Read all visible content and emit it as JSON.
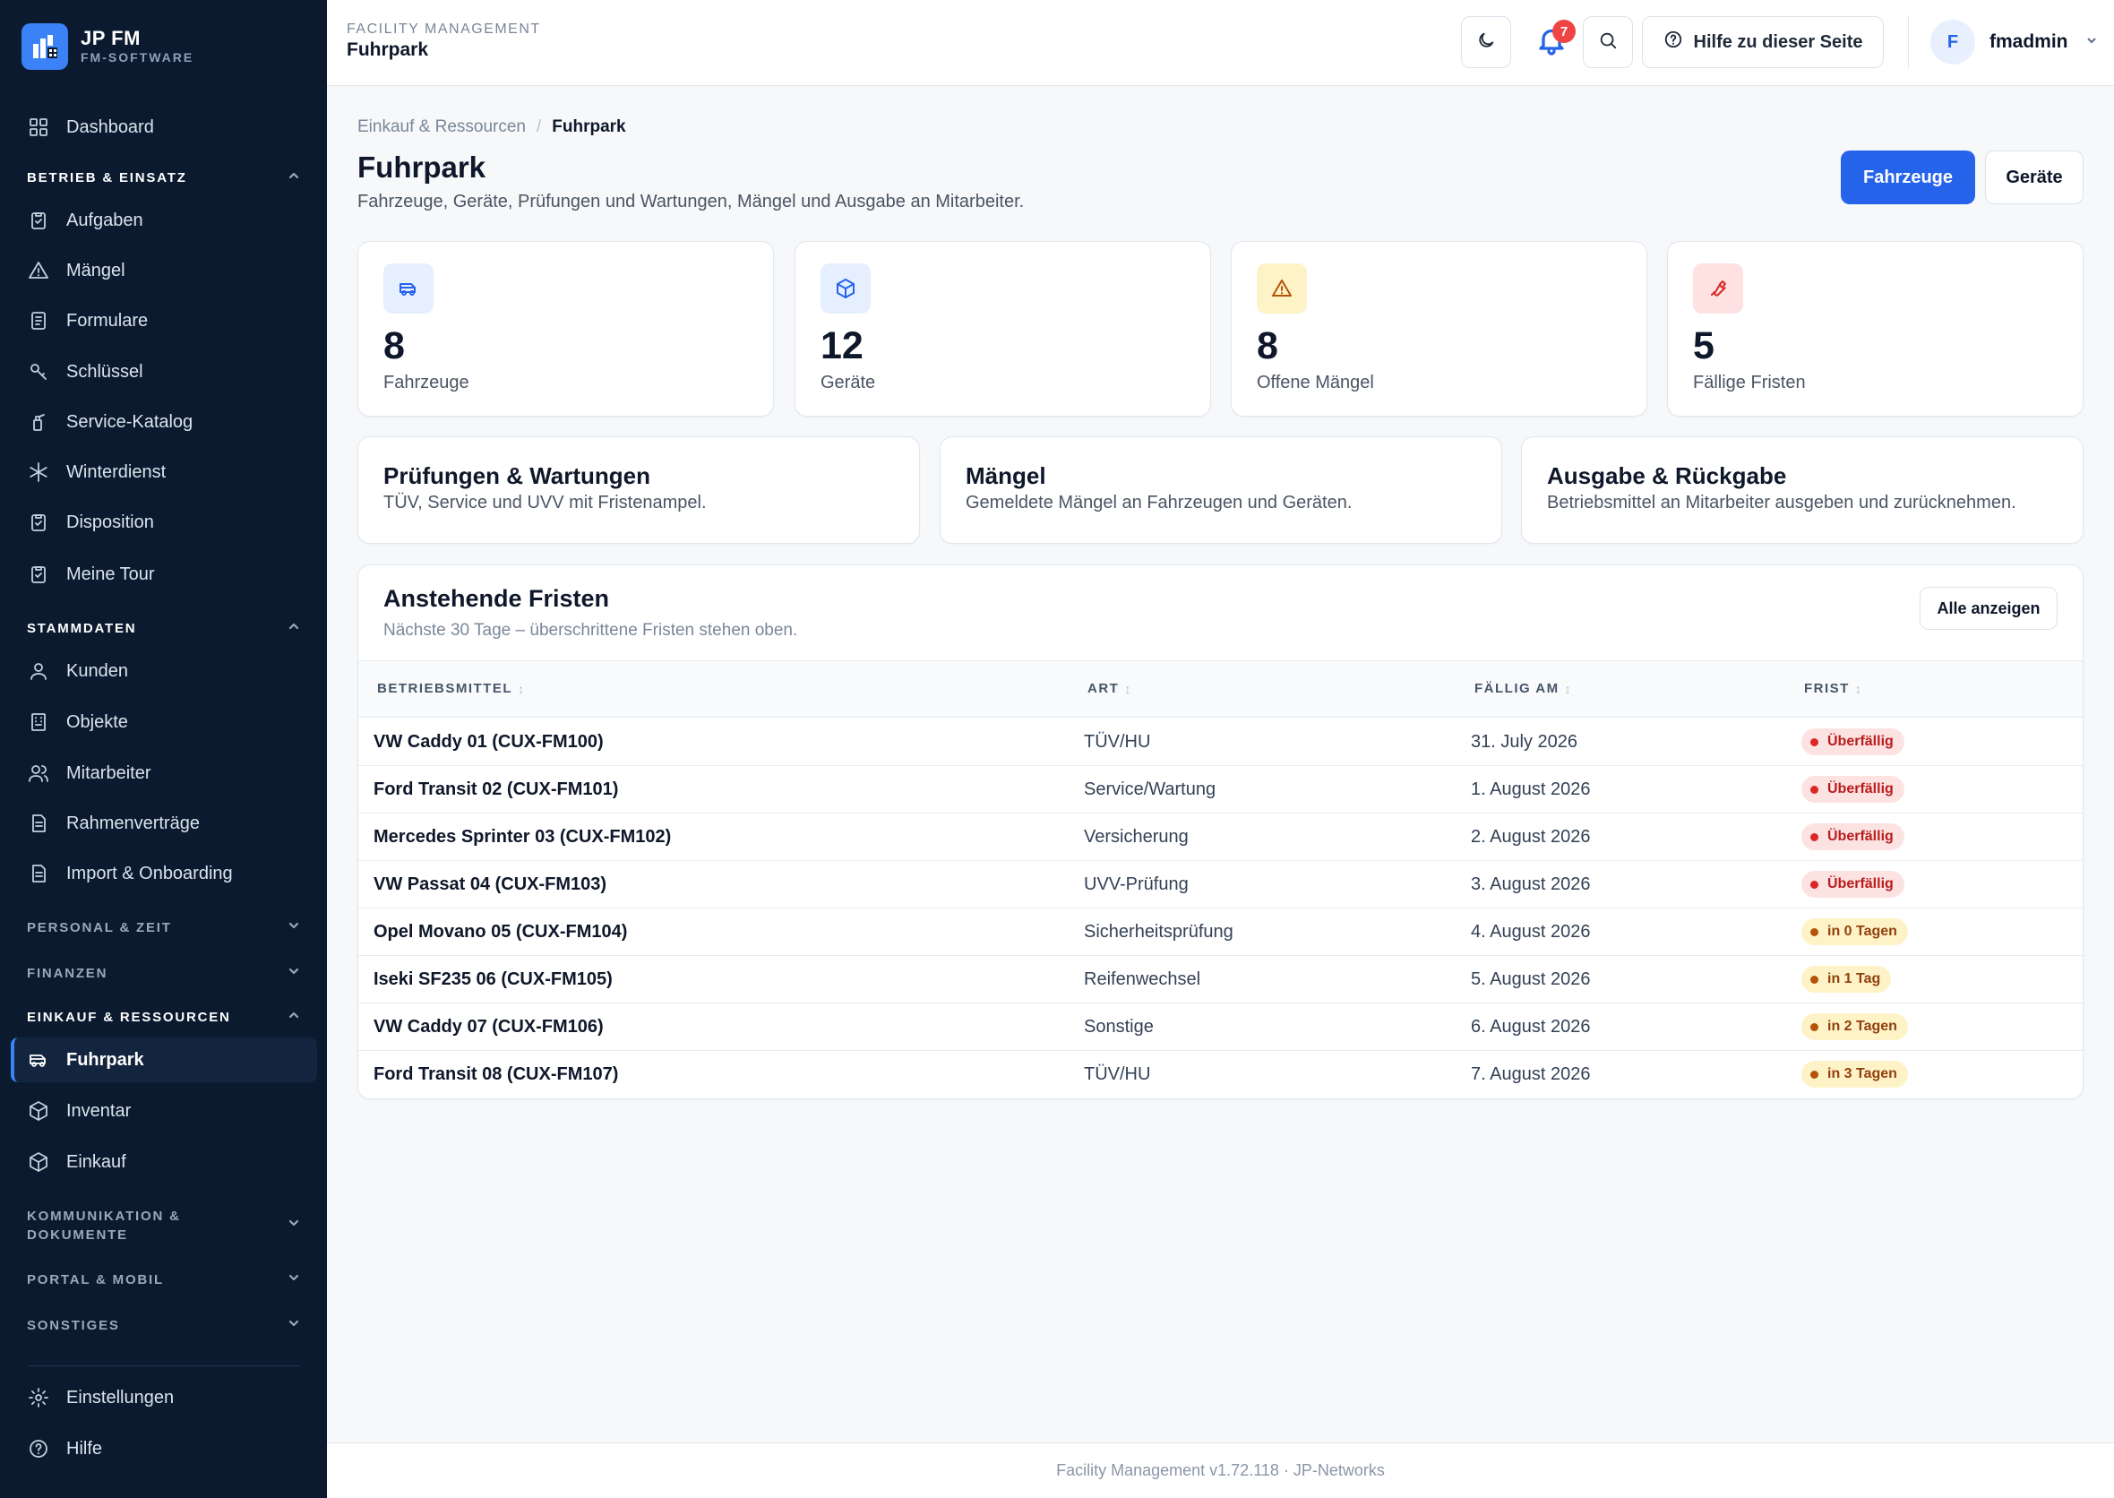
{
  "brand": {
    "name": "JP FM",
    "subtitle": "FM-SOFTWARE"
  },
  "sidebar": {
    "dashboard": "Dashboard",
    "sections": {
      "betrieb": "BETRIEB & EINSATZ",
      "stammdaten": "STAMMDATEN",
      "personal": "PERSONAL & ZEIT",
      "finanzen": "FINANZEN",
      "einkauf": "EINKAUF & RESSOURCEN",
      "kommunikation_1": "KOMMUNIKATION &",
      "kommunikation_2": "DOKUMENTE",
      "portal": "PORTAL & MOBIL",
      "sonstiges": "SONSTIGES"
    },
    "betrieb_items": [
      "Aufgaben",
      "Mängel",
      "Formulare",
      "Schlüssel",
      "Service-Katalog",
      "Winterdienst",
      "Disposition",
      "Meine Tour"
    ],
    "stammdaten_items": [
      "Kunden",
      "Objekte",
      "Mitarbeiter",
      "Rahmenverträge",
      "Import & Onboarding"
    ],
    "einkauf_items": [
      "Fuhrpark",
      "Inventar",
      "Einkauf"
    ],
    "bottom_items": [
      "Einstellungen",
      "Hilfe"
    ]
  },
  "topbar": {
    "section": "FACILITY MANAGEMENT",
    "title": "Fuhrpark",
    "notification_count": "7",
    "help_label": "Hilfe zu dieser Seite",
    "avatar_initial": "F",
    "username": "fmadmin"
  },
  "breadcrumb": {
    "parent": "Einkauf & Ressourcen",
    "separator": "/",
    "current": "Fuhrpark"
  },
  "header": {
    "title": "Fuhrpark",
    "subtitle": "Fahrzeuge, Geräte, Prüfungen und Wartungen, Mängel und Ausgabe an Mitarbeiter.",
    "btn_primary": "Fahrzeuge",
    "btn_secondary": "Geräte"
  },
  "stats": [
    {
      "value": "8",
      "label": "Fahrzeuge",
      "icon": "van-icon",
      "bg": "#e6efff",
      "color": "#2563eb"
    },
    {
      "value": "12",
      "label": "Geräte",
      "icon": "box-icon",
      "bg": "#e6efff",
      "color": "#2563eb"
    },
    {
      "value": "8",
      "label": "Offene Mängel",
      "icon": "warning-icon",
      "bg": "#fef3c7",
      "color": "#b45309"
    },
    {
      "value": "5",
      "label": "Fällige Fristen",
      "icon": "wrench-icon",
      "bg": "#fee2e2",
      "color": "#dc2626"
    }
  ],
  "link_cards": [
    {
      "title": "Prüfungen & Wartungen",
      "subtitle": "TÜV, Service und UVV mit Fristenampel."
    },
    {
      "title": "Mängel",
      "subtitle": "Gemeldete Mängel an Fahrzeugen und Geräten."
    },
    {
      "title": "Ausgabe & Rückgabe",
      "subtitle": "Betriebsmittel an Mitarbeiter ausgeben und zurücknehmen."
    }
  ],
  "deadlines": {
    "title": "Anstehende Fristen",
    "subtitle": "Nächste 30 Tage – überschrittene Fristen stehen oben.",
    "show_all": "Alle anzeigen",
    "columns": [
      "BETRIEBSMITTEL",
      "ART",
      "FÄLLIG AM",
      "FRIST"
    ],
    "rows": [
      {
        "name": "VW Caddy 01 (CUX-FM100)",
        "art": "TÜV/HU",
        "date": "31. July 2026",
        "status": "Überfällig",
        "level": "overdue"
      },
      {
        "name": "Ford Transit 02 (CUX-FM101)",
        "art": "Service/Wartung",
        "date": "1. August 2026",
        "status": "Überfällig",
        "level": "overdue"
      },
      {
        "name": "Mercedes Sprinter 03 (CUX-FM102)",
        "art": "Versicherung",
        "date": "2. August 2026",
        "status": "Überfällig",
        "level": "overdue"
      },
      {
        "name": "VW Passat 04 (CUX-FM103)",
        "art": "UVV-Prüfung",
        "date": "3. August 2026",
        "status": "Überfällig",
        "level": "overdue"
      },
      {
        "name": "Opel Movano 05 (CUX-FM104)",
        "art": "Sicherheitsprüfung",
        "date": "4. August 2026",
        "status": "in 0 Tagen",
        "level": "soon"
      },
      {
        "name": "Iseki SF235 06 (CUX-FM105)",
        "art": "Reifenwechsel",
        "date": "5. August 2026",
        "status": "in 1 Tag",
        "level": "soon"
      },
      {
        "name": "VW Caddy 07 (CUX-FM106)",
        "art": "Sonstige",
        "date": "6. August 2026",
        "status": "in 2 Tagen",
        "level": "soon"
      },
      {
        "name": "Ford Transit 08 (CUX-FM107)",
        "art": "TÜV/HU",
        "date": "7. August 2026",
        "status": "in 3 Tagen",
        "level": "soon"
      }
    ]
  },
  "status_colors": {
    "overdue": {
      "bg": "#fde2e2",
      "text": "#b91c1c",
      "dot": "#dc2626"
    },
    "soon": {
      "bg": "#fef3c7",
      "text": "#92400e",
      "dot": "#b45309"
    }
  },
  "footer": "Facility Management v1.72.118 · JP-Networks"
}
